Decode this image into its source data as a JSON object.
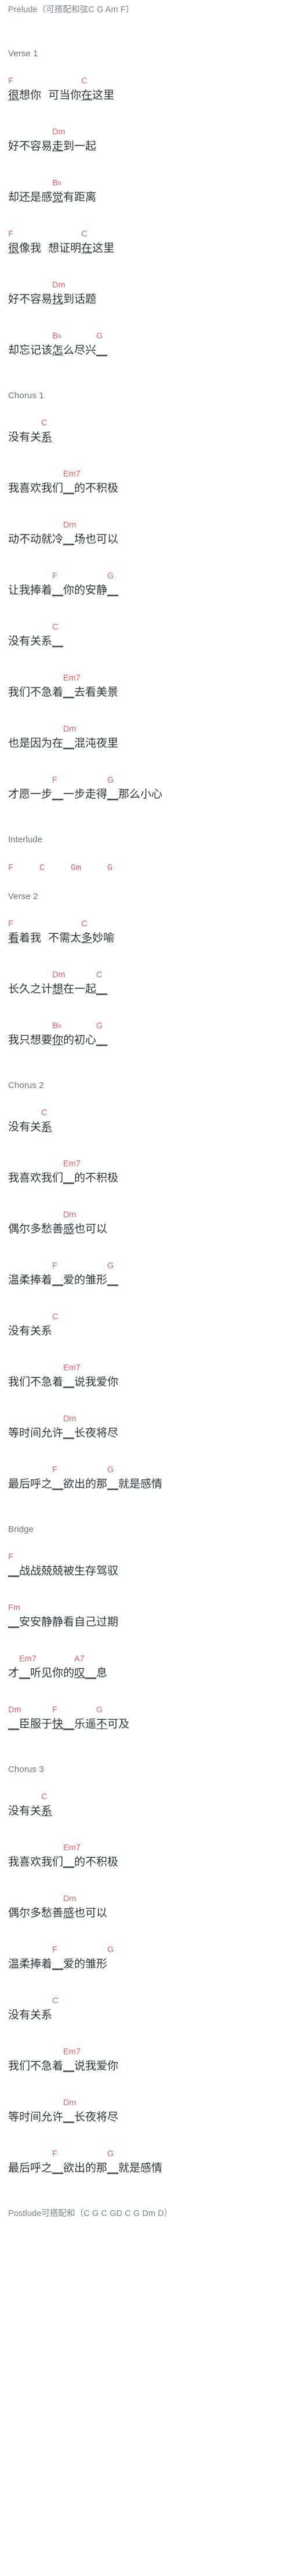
{
  "document": {
    "kind": "chord-chart",
    "language": "zh-CN",
    "chord_color": "#d4676a",
    "lyric_color": "#2f3336",
    "section_color": "#6b7176",
    "background": "#ffffff"
  },
  "prelude": {
    "text": "Prelude（可搭配和弦C G Am F）"
  },
  "postlude": {
    "text": "Postlude可搭配和（C G C GD C G Dm D）"
  },
  "sections": [
    {
      "id": "verse-1",
      "title": "Verse 1"
    },
    {
      "id": "chorus-1",
      "title": "Chorus 1"
    },
    {
      "id": "interlude",
      "title": "Interlude"
    },
    {
      "id": "verse-2",
      "title": "Verse 2"
    },
    {
      "id": "chorus-2",
      "title": "Chorus 2"
    },
    {
      "id": "bridge",
      "title": "Bridge"
    },
    {
      "id": "chorus-3",
      "title": "Chorus 3"
    }
  ],
  "interlude_chords": "F     C     Gm     G",
  "lines": {
    "v1_1_chords": "F              C",
    "v1_1_lyrics": "很想你  可当你在这里",
    "v1_2_chords": "       Dm",
    "v1_2_lyrics": "好不容易走到一起",
    "v1_3_chords": "       B♭",
    "v1_3_lyrics": "却还是感觉有距离",
    "v1_4_chords": "F              C",
    "v1_4_lyrics": "很像我  想证明在这里",
    "v1_5_chords": "       Dm",
    "v1_5_lyrics": "好不容易找到话题",
    "v1_6_chords": "       B♭       G",
    "v1_6_lyrics": "却忘记该怎么尽兴__",
    "c1_1_chords": "      C",
    "c1_1_lyrics": "没有关系",
    "c1_2_chords": "          Em7",
    "c1_2_lyrics": "我喜欢我们__的不积极",
    "c1_3_chords": "          Dm",
    "c1_3_lyrics": "动不动就冷__场也可以",
    "c1_4_chords": "        F          G",
    "c1_4_lyrics": "让我捧着__你的安静__",
    "c1_5_chords": "        C",
    "c1_5_lyrics": "没有关系__",
    "c1_6_chords": "          Em7",
    "c1_6_lyrics": "我们不急着__去看美景",
    "c1_7_chords": "          Dm",
    "c1_7_lyrics": "也是因为在__混沌夜里",
    "c1_8_chords": "        F          G",
    "c1_8_lyrics": "才愿一步__一步走得__那么小心",
    "v2_1_chords": "F              C",
    "v2_1_lyrics": "看着我  不需太多妙喻",
    "v2_2_chords": "       Dm       C",
    "v2_2_lyrics": "长久之计想在一起__",
    "v2_3_chords": "       B♭       G",
    "v2_3_lyrics": "我只想要你的初心__",
    "c2_1_chords": "      C",
    "c2_1_lyrics": "没有关系",
    "c2_2_chords": "          Em7",
    "c2_2_lyrics": "我喜欢我们__的不积极",
    "c2_3_chords": "          Dm",
    "c2_3_lyrics": "偶尔多愁善感也可以",
    "c2_4_chords": "        F          G",
    "c2_4_lyrics": "温柔捧着__爱的雏形__",
    "c2_5_chords": "        C",
    "c2_5_lyrics": "没有关系",
    "c2_6_chords": "          Em7",
    "c2_6_lyrics": "我们不急着__说我爱你",
    "c2_7_chords": "          Dm",
    "c2_7_lyrics": "等时间允许__长夜将尽",
    "c2_8_chords": "        F          G",
    "c2_8_lyrics": "最后呼之__欲出的那__就是感情",
    "b_1_chords": "F",
    "b_1_lyrics": "__战战兢兢被生存驾驭",
    "b_2_chords": "Fm",
    "b_2_lyrics": "__安安静静看自己过期",
    "b_3_chords": "  Em7         A7",
    "b_3_lyrics": "才__听见你的叹__息",
    "b_4_chords": "Dm       F         G",
    "b_4_lyrics": "__臣服于快__乐遥不可及",
    "c3_1_chords": "      C",
    "c3_1_lyrics": "没有关系",
    "c3_2_chords": "          Em7",
    "c3_2_lyrics": "我喜欢我们__的不积极",
    "c3_3_chords": "          Dm",
    "c3_3_lyrics": "偶尔多愁善感也可以",
    "c3_4_chords": "        F          G",
    "c3_4_lyrics": "温柔捧着__爱的雏形",
    "c3_5_chords": "        C",
    "c3_5_lyrics": "没有关系",
    "c3_6_chords": "          Em7",
    "c3_6_lyrics": "我们不急着__说我爱你",
    "c3_7_chords": "          Dm",
    "c3_7_lyrics": "等时间允许__长夜将尽",
    "c3_8_chords": "        F          G",
    "c3_8_lyrics": "最后呼之__欲出的那__就是感情"
  },
  "chords_used": [
    "C",
    "G",
    "Am",
    "F",
    "Dm",
    "B♭",
    "Em7",
    "Gm",
    "Fm",
    "A7",
    "D"
  ]
}
